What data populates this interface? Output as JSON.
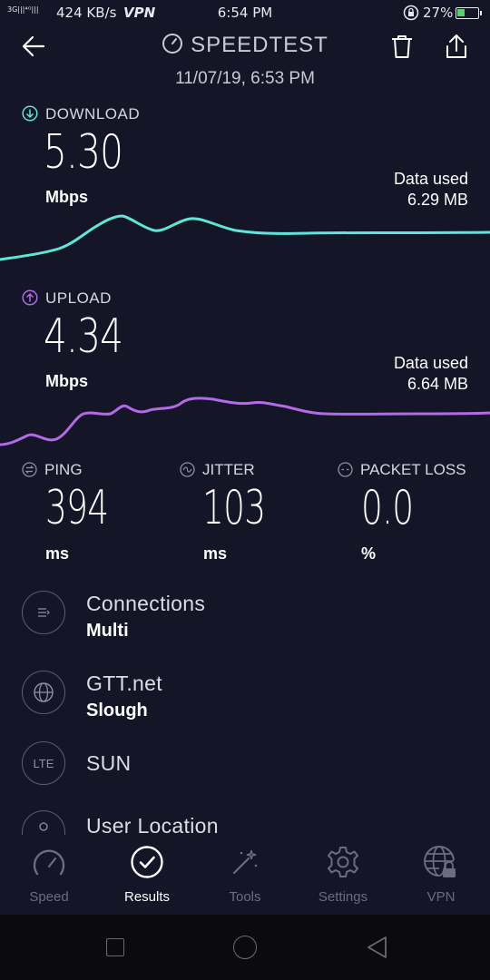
{
  "status_bar": {
    "signal": "3G|||⁴ᴳ|||",
    "speed": "424 KB/s",
    "vpn": "VPN",
    "time": "6:54 PM",
    "battery": "27%"
  },
  "header": {
    "title": "SPEEDTEST",
    "date": "11/07/19, 6:53 PM"
  },
  "download": {
    "label": "DOWNLOAD",
    "value": "5.30",
    "unit": "Mbps",
    "data_used_label": "Data used",
    "data_used_value": "6.29 MB",
    "color": "#5ee6d9"
  },
  "upload": {
    "label": "UPLOAD",
    "value": "4.34",
    "unit": "Mbps",
    "data_used_label": "Data used",
    "data_used_value": "6.64 MB",
    "color": "#b46ae6"
  },
  "metrics": [
    {
      "label": "PING",
      "value": "394",
      "unit": "ms"
    },
    {
      "label": "JITTER",
      "value": "103",
      "unit": "ms"
    },
    {
      "label": "PACKET LOSS",
      "value": "0.0",
      "unit": "%"
    }
  ],
  "info": {
    "connections": {
      "title": "Connections",
      "sub": "Multi"
    },
    "server": {
      "title": "GTT.net",
      "sub": "Slough"
    },
    "provider": {
      "icon_text": "LTE",
      "title": "SUN"
    },
    "location": {
      "title": "User Location"
    }
  },
  "nav": [
    {
      "label": "Speed",
      "icon": "speedometer-icon"
    },
    {
      "label": "Results",
      "icon": "check-circle-icon",
      "active": true
    },
    {
      "label": "Tools",
      "icon": "magic-wand-icon"
    },
    {
      "label": "Settings",
      "icon": "gear-icon"
    },
    {
      "label": "VPN",
      "icon": "globe-lock-icon"
    }
  ]
}
